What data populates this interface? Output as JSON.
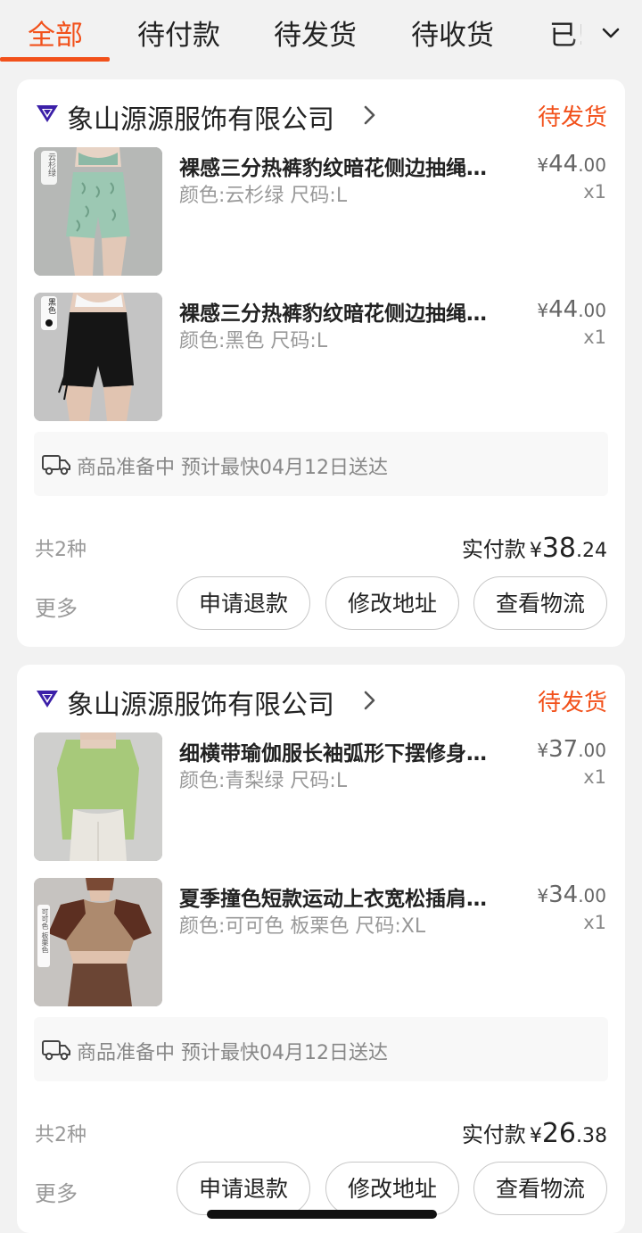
{
  "tabs": [
    {
      "label": "全部",
      "active": true
    },
    {
      "label": "待付款"
    },
    {
      "label": "待发货"
    },
    {
      "label": "待收货"
    },
    {
      "label": "已!"
    }
  ],
  "colors": {
    "accent": "#f2511b",
    "background": "#f2f2f2",
    "card": "#ffffff",
    "muted": "#999999"
  },
  "icons": {
    "tab_more": "chevron-down-icon",
    "shop_logo": "shop-diamond-logo",
    "shop_arrow": "chevron-right-icon",
    "delivery": "truck-icon"
  },
  "orders": [
    {
      "shop_name": "象山源源服饰有限公司",
      "status": "待发货",
      "items": [
        {
          "title": "裸感三分热裤豹纹暗花侧边抽绳瑜伽短裤",
          "spec": "颜色:云杉绿 尺码:L",
          "price_currency": "¥",
          "price_int": "44",
          "price_dec": ".00",
          "qty": "x1",
          "thumb_tag": "云杉绿"
        },
        {
          "title": "裸感三分热裤豹纹暗花侧边抽绳瑜伽短裤",
          "spec": "颜色:黑色 尺码:L",
          "price_currency": "¥",
          "price_int": "44",
          "price_dec": ".00",
          "qty": "x1",
          "thumb_tag": "黑色"
        }
      ],
      "delivery": "商品准备中 预计最快04月12日送达",
      "count": "共2种",
      "paid_label": "实付款",
      "paid_currency": "¥",
      "paid_int": "38",
      "paid_dec": ".24",
      "more": "更多",
      "buttons": [
        "申请退款",
        "修改地址",
        "查看物流"
      ]
    },
    {
      "shop_name": "象山源源服饰有限公司",
      "status": "待发货",
      "items": [
        {
          "title": "细横带瑜伽服长袖弧形下摆修身运动上衣",
          "spec": "颜色:青梨绿 尺码:L",
          "price_currency": "¥",
          "price_int": "37",
          "price_dec": ".00",
          "qty": "x1",
          "thumb_tag": ""
        },
        {
          "title": "夏季撞色短款运动上衣宽松插肩袖T恤",
          "spec": "颜色:可可色 板栗色 尺码:XL",
          "price_currency": "¥",
          "price_int": "34",
          "price_dec": ".00",
          "qty": "x1",
          "thumb_tag": "可可色 板栗色"
        }
      ],
      "delivery": "商品准备中 预计最快04月12日送达",
      "count": "共2种",
      "paid_label": "实付款",
      "paid_currency": "¥",
      "paid_int": "26",
      "paid_dec": ".38",
      "more": "更多",
      "buttons": [
        "申请退款",
        "修改地址",
        "查看物流"
      ]
    }
  ]
}
